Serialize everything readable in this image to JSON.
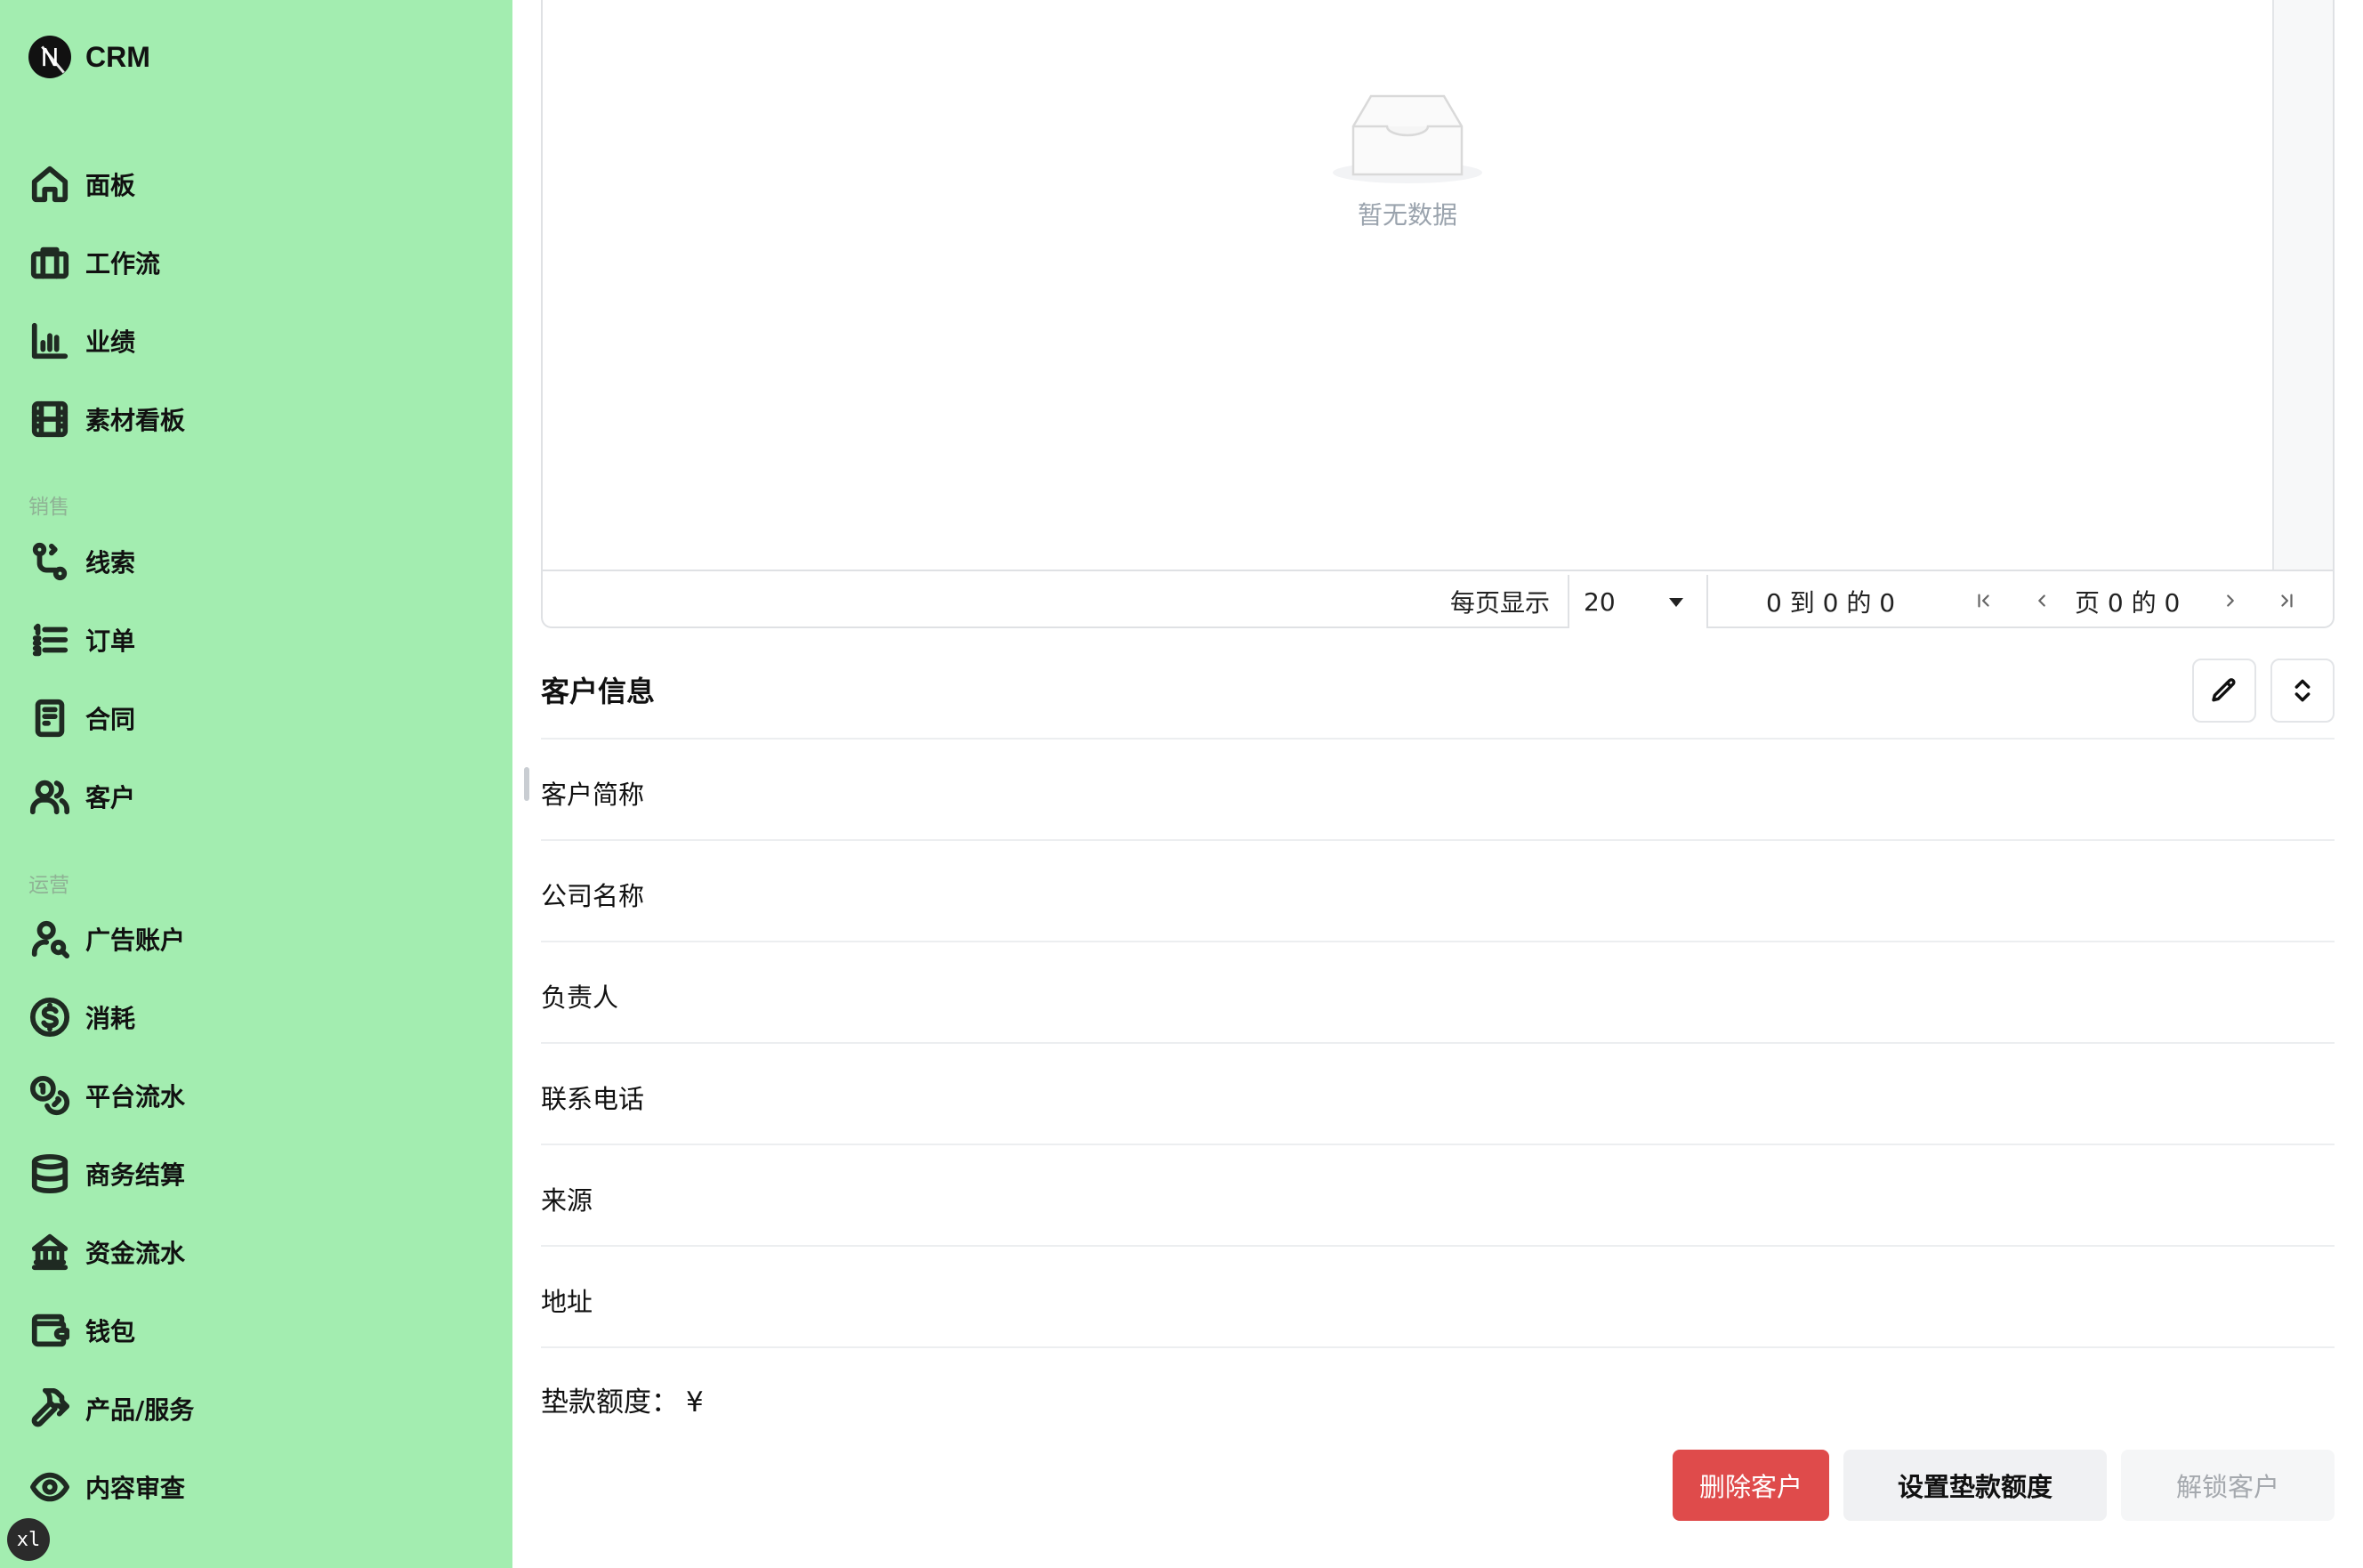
{
  "app": {
    "name": "CRM",
    "logo_letter": "N",
    "user_initials": "xl"
  },
  "sidebar": {
    "items": [
      {
        "label": "面板",
        "icon": "home-icon"
      },
      {
        "label": "工作流",
        "icon": "briefcase-icon"
      },
      {
        "label": "业绩",
        "icon": "bar-chart-icon"
      },
      {
        "label": "素材看板",
        "icon": "film-icon"
      },
      {
        "label": "线索",
        "icon": "git-branch-icon"
      },
      {
        "label": "订单",
        "icon": "list-icon"
      },
      {
        "label": "合同",
        "icon": "document-icon"
      },
      {
        "label": "客户",
        "icon": "users-icon"
      },
      {
        "label": "广告账户",
        "icon": "user-search-icon"
      },
      {
        "label": "消耗",
        "icon": "dollar-circle-icon"
      },
      {
        "label": "平台流水",
        "icon": "coins-icon"
      },
      {
        "label": "商务结算",
        "icon": "database-icon"
      },
      {
        "label": "资金流水",
        "icon": "bank-icon"
      },
      {
        "label": "钱包",
        "icon": "wallet-icon"
      },
      {
        "label": "产品/服务",
        "icon": "hammer-icon"
      },
      {
        "label": "内容审查",
        "icon": "eye-icon"
      }
    ],
    "sections": {
      "sales": "销售",
      "operations": "运营"
    }
  },
  "grid": {
    "empty_text": "暂无数据",
    "page_size_label": "每页显示",
    "page_size_value": "20",
    "range_text": "0 到 0 的 0",
    "page_text": "页 0 的 0"
  },
  "customer": {
    "title": "客户信息",
    "fields": [
      "客户简称",
      "公司名称",
      "负责人",
      "联系电话",
      "来源",
      "地址"
    ],
    "quota_label": "垫款额度：",
    "quota_value": "¥"
  },
  "actions": {
    "delete": "删除客户",
    "set_quota": "设置垫款额度",
    "unlock": "解锁客户"
  },
  "colors": {
    "sidebar_bg": "#a3edb0",
    "danger": "#df4b4b",
    "secondary_bg": "#f0f1f3",
    "disabled_text": "#a5a9ae"
  }
}
